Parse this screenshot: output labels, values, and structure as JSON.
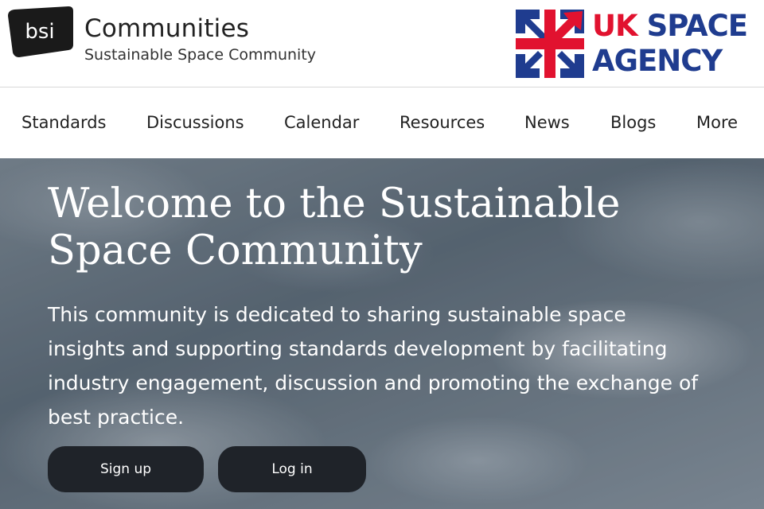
{
  "header": {
    "bsi_logo_text": "bsi",
    "title": "Communities",
    "subtitle": "Sustainable Space Community",
    "partner_logo": {
      "line1_part1": "UK",
      "line1_part2": "SPACE",
      "line2": "AGENCY"
    }
  },
  "nav": {
    "items": [
      {
        "label": "Standards"
      },
      {
        "label": "Discussions"
      },
      {
        "label": "Calendar"
      },
      {
        "label": "Resources"
      },
      {
        "label": "News"
      },
      {
        "label": "Blogs"
      },
      {
        "label": "More"
      }
    ]
  },
  "hero": {
    "title": "Welcome to the Sustainable Space Community",
    "text": "This community is dedicated to sharing sustainable space insights and supporting standards development by facilitating industry engagement, discussion and promoting the exchange of best practice.",
    "signup_label": "Sign up",
    "login_label": "Log in"
  },
  "colors": {
    "uk_red": "#e1122f",
    "uk_blue": "#1f3c8f",
    "button_bg": "#1f2329",
    "logo_black": "#1a1a1a"
  }
}
